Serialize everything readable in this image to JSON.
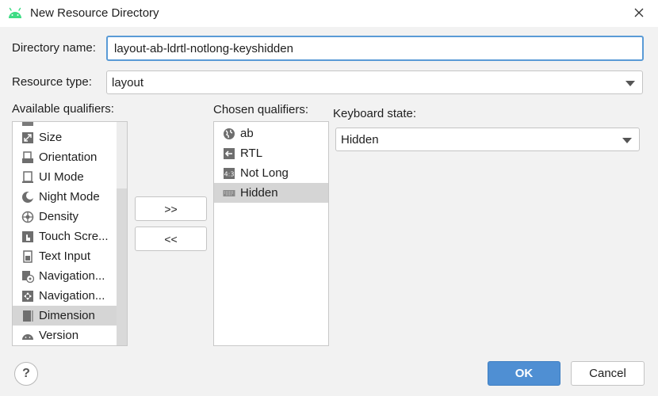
{
  "window": {
    "title": "New Resource Directory"
  },
  "directory": {
    "label": "Directory name:",
    "value": "layout-ab-ldrtl-notlong-keyshidden"
  },
  "resource_type": {
    "label": "Resource type:",
    "value": "layout"
  },
  "available": {
    "label": "Available qualifiers:",
    "items": [
      {
        "label": "Size",
        "icon": "size-icon"
      },
      {
        "label": "Orientation",
        "icon": "orientation-icon"
      },
      {
        "label": "UI Mode",
        "icon": "ui-mode-icon"
      },
      {
        "label": "Night Mode",
        "icon": "night-mode-icon"
      },
      {
        "label": "Density",
        "icon": "density-icon"
      },
      {
        "label": "Touch Scre...",
        "icon": "touch-screen-icon"
      },
      {
        "label": "Text Input",
        "icon": "text-input-icon"
      },
      {
        "label": "Navigation...",
        "icon": "navigation-icon"
      },
      {
        "label": "Navigation...",
        "icon": "navigation-icon"
      },
      {
        "label": "Dimension",
        "icon": "dimension-icon"
      },
      {
        "label": "Version",
        "icon": "android-icon"
      }
    ]
  },
  "transfer": {
    "add_label": ">>",
    "remove_label": "<<"
  },
  "chosen": {
    "label": "Chosen qualifiers:",
    "items": [
      {
        "label": "ab",
        "icon": "globe-icon"
      },
      {
        "label": "RTL",
        "icon": "rtl-arrow-icon"
      },
      {
        "label": "Not Long",
        "icon": "ratio-icon"
      },
      {
        "label": "Hidden",
        "icon": "keyboard-icon"
      }
    ]
  },
  "keyboard_state": {
    "label": "Keyboard state:",
    "value": "Hidden"
  },
  "buttons": {
    "help": "?",
    "ok": "OK",
    "cancel": "Cancel"
  },
  "colors": {
    "accent": "#4f8fd3",
    "focus_border": "#5a9bd6",
    "selection": "#d5d5d5"
  }
}
